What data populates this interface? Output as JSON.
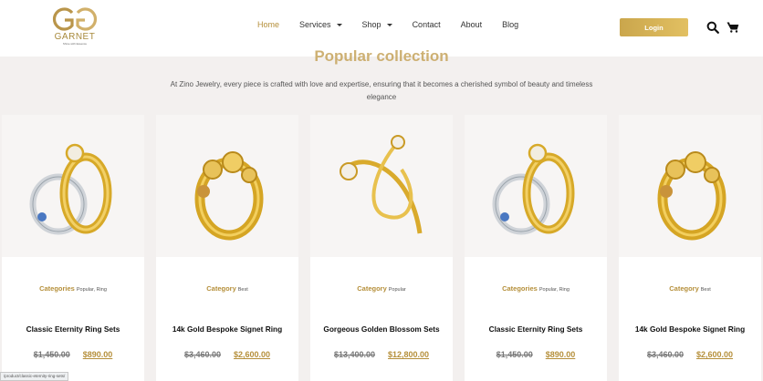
{
  "brand": {
    "name": "GARNET",
    "tagline": "Shine with Essence",
    "accent": "#b58f3a"
  },
  "nav": {
    "items": [
      {
        "label": "Home",
        "active": true,
        "dropdown": false
      },
      {
        "label": "Services",
        "active": false,
        "dropdown": true
      },
      {
        "label": "Shop",
        "active": false,
        "dropdown": true
      },
      {
        "label": "Contact",
        "active": false,
        "dropdown": false
      },
      {
        "label": "About",
        "active": false,
        "dropdown": false
      },
      {
        "label": "Blog",
        "active": false,
        "dropdown": false
      }
    ],
    "login_label": "Login",
    "icons": [
      "search-icon",
      "cart-icon"
    ]
  },
  "section": {
    "title": "Popular collection",
    "subtitle": "At Zino Jewelry, every piece is crafted with love and expertise, ensuring that it becomes a cherished symbol of beauty and timeless elegance"
  },
  "products": [
    {
      "cat_label": "Categories",
      "cat_values": "Popular, Ring",
      "title": "Classic Eternity Ring Sets",
      "old_price": "$1,450.00",
      "new_price": "$890.00",
      "image": "eternity-ring-set"
    },
    {
      "cat_label": "Category",
      "cat_values": "Best",
      "title": "14k Gold Bespoke Signet Ring",
      "old_price": "$3,460.00",
      "new_price": "$2,600.00",
      "image": "flower-signet-ring"
    },
    {
      "cat_label": "Category",
      "cat_values": "Popular",
      "title": "Gorgeous Golden Blossom Sets",
      "old_price": "$13,400.00",
      "new_price": "$12,800.00",
      "image": "crossover-ring"
    },
    {
      "cat_label": "Categories",
      "cat_values": "Popular, Ring",
      "title": "Classic Eternity Ring Sets",
      "old_price": "$1,450.00",
      "new_price": "$890.00",
      "image": "eternity-ring-set"
    },
    {
      "cat_label": "Category",
      "cat_values": "Best",
      "title": "14k Gold Bespoke Signet Ring",
      "old_price": "$3,460.00",
      "new_price": "$2,600.00",
      "image": "flower-signet-ring"
    }
  ],
  "status_url": "/product/classic-eternity-ring-sets/"
}
